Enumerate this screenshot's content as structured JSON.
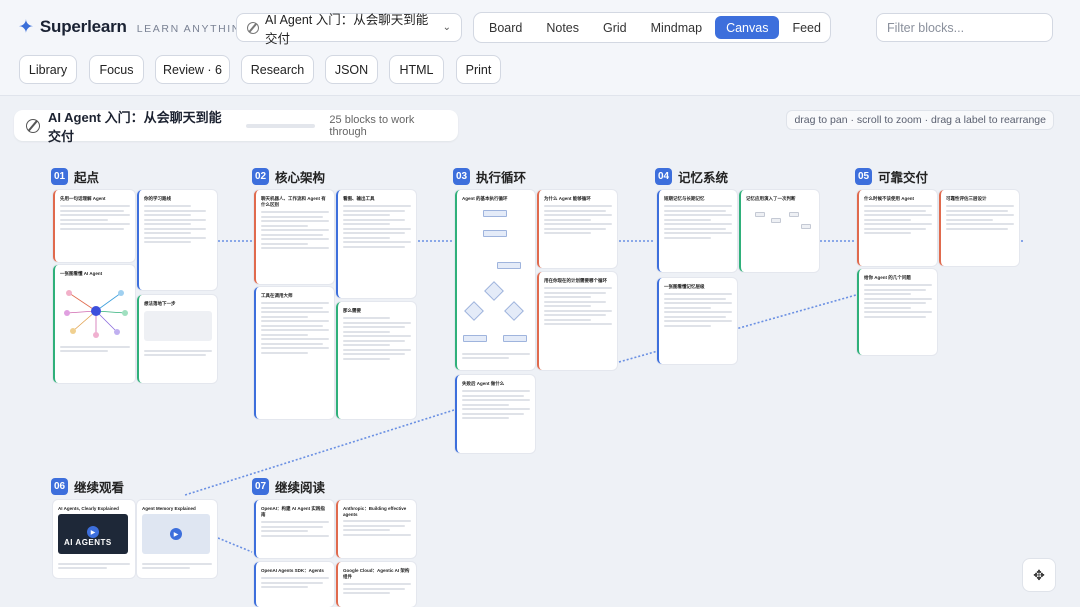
{
  "app": {
    "name": "Superlearn",
    "tagline": "LEARN ANYTHING"
  },
  "deck_select": {
    "value": "AI Agent 入门：从会聊天到能交付"
  },
  "views": [
    "Board",
    "Notes",
    "Grid",
    "Mindmap",
    "Canvas",
    "Feed"
  ],
  "active_view": "Canvas",
  "filter": {
    "placeholder": "Filter blocks..."
  },
  "toolbar": [
    "Library",
    "Focus",
    "Review · 6",
    "Research",
    "JSON",
    "HTML",
    "Print"
  ],
  "canvas": {
    "title": "AI Agent 入门：从会聊天到能交付",
    "progress": 0.0,
    "progress_text": "25 blocks to work through",
    "hint": "drag to pan · scroll to zoom · drag a label to rearrange"
  },
  "sections": [
    {
      "num": "01",
      "title": "起点"
    },
    {
      "num": "02",
      "title": "核心架构"
    },
    {
      "num": "03",
      "title": "执行循环"
    },
    {
      "num": "04",
      "title": "记忆系统"
    },
    {
      "num": "05",
      "title": "可靠交付"
    },
    {
      "num": "06",
      "title": "继续观看"
    },
    {
      "num": "07",
      "title": "继续阅读"
    }
  ],
  "cards": {
    "s1a": "先用一句话理解 Agent",
    "s1b": "你的学习路线",
    "s1c": "一张图看懂 AI Agent",
    "s1d": "想法落地下一步",
    "s2a": "聊天机器人、工作流和 Agent 有什么区别",
    "s2b": "看图、输出工具",
    "s2c": "工具在调用大师",
    "s2d": "那么需要",
    "s3a": "Agent 的基本执行循环",
    "s3b": "为什么 Agent 能够循环",
    "s3c": "用在你现在的计划需要哪个循环",
    "s3d": "失败后 Agent 做什么",
    "s4a": "短期记忆与长期记忆",
    "s4b": "记忆应用演入了一次判断",
    "s4c": "一张图看懂记忆层级",
    "s5a": "什么时候不该使用 Agent",
    "s5b": "可靠性评估三层设计",
    "s5c": "给你 Agent 的几个问题",
    "s6a": "AI Agents, Clearly Explained",
    "s6b": "Agent Memory Explained",
    "s6c": "AI AGENTS",
    "s7a": "OpenAI：构建 AI Agent 实践指南",
    "s7b": "Anthropic：Building effective agents",
    "s7c": "OpenAI Agents SDK：Agents",
    "s7d": "Google Cloud：Agentic AI 架构组件"
  },
  "colors": {
    "accent": "#3d6fdc",
    "red": "#e06a4d",
    "green": "#2fb07a"
  }
}
